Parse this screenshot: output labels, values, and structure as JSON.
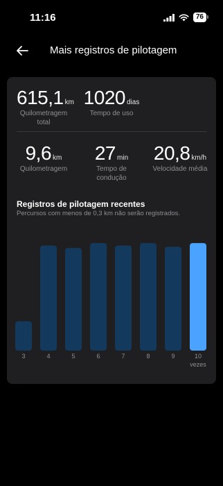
{
  "status_bar": {
    "time": "11:16",
    "battery": "76"
  },
  "nav": {
    "title": "Mais registros de pilotagem"
  },
  "stats": {
    "total_distance": {
      "value": "615,1",
      "unit": "km",
      "label_line1": "Quilometragem",
      "label_line2": "total"
    },
    "usage_time": {
      "value": "1020",
      "unit": "dias",
      "label_line1": "Tempo de uso"
    },
    "distance": {
      "value": "9,6",
      "unit": "km",
      "label_line1": "Quilometragem"
    },
    "ride_time": {
      "value": "27",
      "unit": "min",
      "label_line1": "Tempo de",
      "label_line2": "condução"
    },
    "avg_speed": {
      "value": "20,8",
      "unit": "km/h",
      "label_line1": "Velocidade média"
    }
  },
  "recent": {
    "title": "Registros de pilotagem recentes",
    "subtitle": "Percursos com menos de 0,3 km não serão registrados."
  },
  "colors": {
    "bar": "#133a5c",
    "bar_selected": "#4aa3ff",
    "card": "#1f1f21",
    "background": "#000000"
  },
  "chart_data": {
    "type": "bar",
    "categories": [
      "3",
      "4",
      "5",
      "6",
      "7",
      "8",
      "9",
      "10"
    ],
    "values": [
      24,
      86,
      84,
      88,
      86,
      88,
      85,
      88
    ],
    "selected_index": 7,
    "xlabel": "vezes",
    "ylim": [
      0,
      100
    ]
  }
}
